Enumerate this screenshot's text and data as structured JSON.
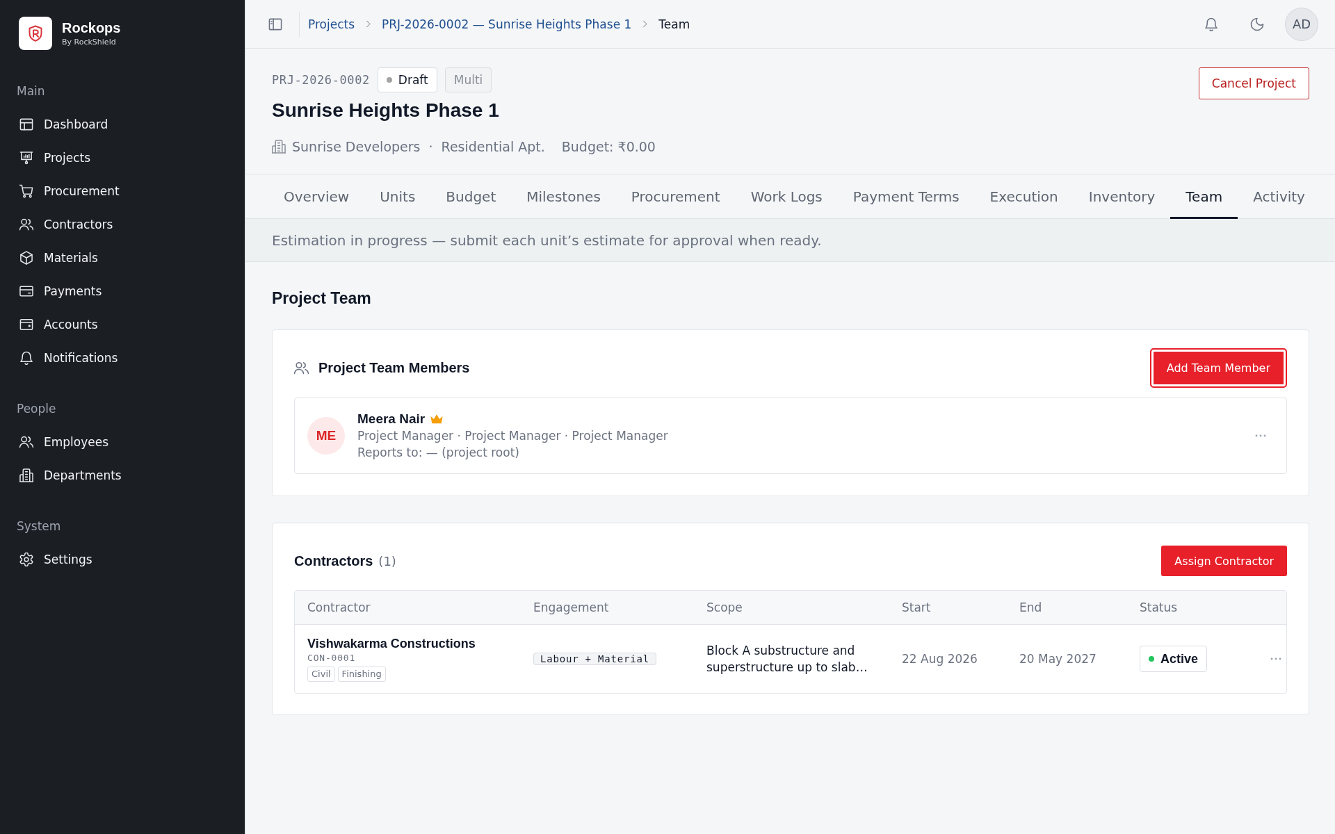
{
  "sidebar": {
    "brand": {
      "name": "Rockops",
      "tagline": "By RockShield"
    },
    "sections": [
      {
        "title": "Main",
        "items": [
          {
            "label": "Dashboard",
            "selected": false
          },
          {
            "label": "Projects",
            "selected": false
          },
          {
            "label": "Procurement",
            "selected": false
          },
          {
            "label": "Contractors",
            "selected": false
          },
          {
            "label": "Materials",
            "selected": false
          },
          {
            "label": "Payments",
            "selected": false
          },
          {
            "label": "Accounts",
            "selected": false
          },
          {
            "label": "Notifications",
            "selected": false
          }
        ]
      },
      {
        "title": "People",
        "items": [
          {
            "label": "Employees",
            "selected": false
          },
          {
            "label": "Departments",
            "selected": false
          }
        ]
      },
      {
        "title": "System",
        "items": [
          {
            "label": "Settings",
            "selected": false
          }
        ]
      }
    ]
  },
  "topbar": {
    "breadcrumbs": [
      {
        "label": "Projects",
        "current": false
      },
      {
        "label": "PRJ-2026-0002 — Sunrise Heights Phase 1",
        "current": false
      },
      {
        "label": "Team",
        "current": true
      }
    ],
    "avatar": "AD"
  },
  "project": {
    "code": "PRJ-2026-0002",
    "badges": [
      {
        "label": "Draft",
        "kind": "status",
        "color": "#a3a3a3"
      },
      {
        "label": "Multi",
        "kind": "tag"
      }
    ],
    "title": "Sunrise Heights Phase 1",
    "client": "Sunrise Developers",
    "separator": "·",
    "category": "Residential Apt.",
    "budget": "Budget: ₹0.00",
    "action": "Cancel Project"
  },
  "tabs": [
    {
      "label": "Overview",
      "selected": false
    },
    {
      "label": "Units",
      "selected": false
    },
    {
      "label": "Budget",
      "selected": false
    },
    {
      "label": "Milestones",
      "selected": false
    },
    {
      "label": "Procurement",
      "selected": false
    },
    {
      "label": "Work Logs",
      "selected": false
    },
    {
      "label": "Payment Terms",
      "selected": false
    },
    {
      "label": "Execution",
      "selected": false
    },
    {
      "label": "Inventory",
      "selected": false
    },
    {
      "label": "Team",
      "selected": true
    },
    {
      "label": "Activity",
      "selected": false
    }
  ],
  "banner": "Estimation in progress — submit each unit’s estimate for approval when ready.",
  "section_title": "Project Team",
  "team": {
    "title": "Project Team Members",
    "button": {
      "label": "Add Team Member",
      "focused": true
    },
    "members": [
      {
        "initials": "ME",
        "name": "Meera Nair",
        "lead": true,
        "roles": "Project Manager · Project Manager · Project Manager",
        "reports_to": "Reports to: — (project root)"
      }
    ]
  },
  "contractors": {
    "title": "Contractors",
    "count": "(1)",
    "button": "Assign Contractor",
    "table": {
      "columns": [
        "Contractor",
        "Engagement",
        "Scope",
        "Start",
        "End",
        "Status"
      ],
      "rows": [
        {
          "name": "Vishwakarma Constructions",
          "code": "CON-0001",
          "tags": [
            "Civil",
            "Finishing"
          ],
          "engagement": "Labour + Material",
          "scope": "Block A substructure and superstructure up to slab…",
          "start": "22 Aug 2026",
          "end": "20 May 2027",
          "status": {
            "label": "Active",
            "color": "#22c55e"
          }
        }
      ]
    }
  }
}
